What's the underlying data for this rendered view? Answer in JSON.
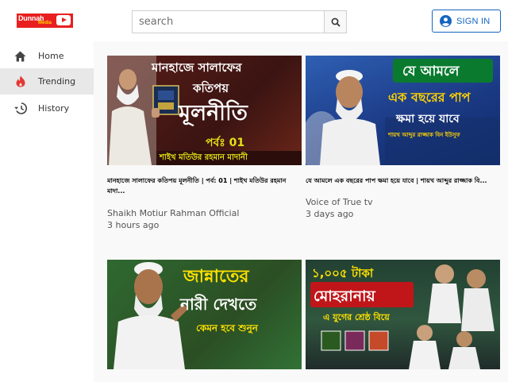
{
  "header": {
    "logo_text": "Dunnah",
    "logo_sub": "Media",
    "search_placeholder": "search",
    "signin_label": "SIGN IN"
  },
  "sidebar": {
    "items": [
      {
        "label": "Home",
        "icon": "home-icon"
      },
      {
        "label": "Trending",
        "icon": "fire-icon",
        "active": true
      },
      {
        "label": "History",
        "icon": "history-icon"
      }
    ]
  },
  "videos": [
    {
      "title": "মানহাজে সালাফের কতিপয় মূলনীতি | পর্ব: 01 | শাইখ মতিউর রহমান মাদা...",
      "channel": "Shaikh Motiur Rahman Official",
      "age": "3 hours ago",
      "thumb": {
        "lines": [
          "মানহাজে সালাফের",
          "কতিপয়",
          "মূলনীতি",
          "পর্বঃ 01",
          "শাইখ মতিউর রহমান মাদানী"
        ],
        "colors": {
          "bg": "#4e1a17",
          "accent": "#e4e115"
        }
      }
    },
    {
      "title": "যে আমলে এক বছরের পাপ ক্ষমা হয়ে যাবে | শায়খ আব্দুর রাজ্জাক বি...",
      "channel": "Voice of True tv",
      "age": "3 days ago",
      "thumb": {
        "lines": [
          "যে আমলে",
          "এক বছরের পাপ",
          "ক্ষমা হয়ে যাবে",
          "শায়খ আব্দুর রাজ্জাক বিন ইউসুফ"
        ],
        "colors": {
          "bg": "#1d3f8a",
          "accent": "#ffd200"
        }
      }
    },
    {
      "title": "",
      "channel": "",
      "age": "",
      "thumb": {
        "lines": [
          "জান্নাতের",
          "নারী দেখতে",
          "কেমন হবে শুনুন"
        ],
        "colors": {
          "bg": "#0c6a2d",
          "accent": "#ffe100"
        }
      }
    },
    {
      "title": "",
      "channel": "",
      "age": "",
      "thumb": {
        "lines": [
          "১,০০৫ টাকা",
          "মোহরানায়",
          "এ যুগের শ্রেষ্ঠ বিয়ে"
        ],
        "colors": {
          "bg": "#6a1f7a",
          "accent": "#ffe100"
        }
      }
    }
  ]
}
